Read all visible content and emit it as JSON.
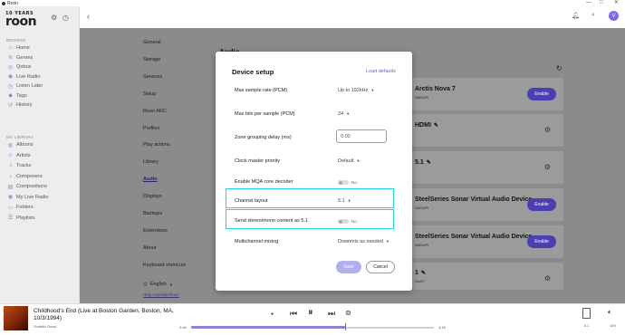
{
  "window": {
    "title": "Roon",
    "min_glyph": "—",
    "max_glyph": "□",
    "close_glyph": "✕"
  },
  "logo": {
    "sub": "10 YEARS",
    "main": "roon"
  },
  "sidebar": {
    "browse_label": "BROWSE",
    "browse_items": [
      {
        "label": "Home",
        "icon": "home-icon",
        "glyph": "⌂"
      },
      {
        "label": "Genres",
        "icon": "genres-icon",
        "glyph": "≋"
      },
      {
        "label": "Qobuz",
        "icon": "qobuz-icon",
        "glyph": "◎"
      },
      {
        "label": "Live Radio",
        "icon": "radio-icon",
        "glyph": "◉"
      },
      {
        "label": "Listen Later",
        "icon": "listen-later-icon",
        "glyph": "◷"
      },
      {
        "label": "Tags",
        "icon": "tag-icon",
        "glyph": "◆"
      },
      {
        "label": "History",
        "icon": "history-icon",
        "glyph": "↺"
      }
    ],
    "library_label": "MY LIBRARY",
    "library_items": [
      {
        "label": "Albums",
        "icon": "album-icon",
        "glyph": "◍"
      },
      {
        "label": "Artists",
        "icon": "artist-icon",
        "glyph": "☺"
      },
      {
        "label": "Tracks",
        "icon": "track-icon",
        "glyph": "♫"
      },
      {
        "label": "Composers",
        "icon": "composer-icon",
        "glyph": "♪"
      },
      {
        "label": "Compositions",
        "icon": "composition-icon",
        "glyph": "▤"
      },
      {
        "label": "My Live Radio",
        "icon": "my-radio-icon",
        "glyph": "◉"
      },
      {
        "label": "Folders",
        "icon": "folder-icon",
        "glyph": "▭"
      },
      {
        "label": "Playlists",
        "icon": "playlist-icon",
        "glyph": "☰"
      }
    ]
  },
  "settings_nav": [
    "General",
    "Storage",
    "Services",
    "Setup",
    "Roon ARC",
    "Profiles",
    "Play actions",
    "Library",
    "Audio",
    "Displays",
    "Backups",
    "Extensions",
    "About",
    "Keyboard shortcuts"
  ],
  "settings_active": "Audio",
  "language": {
    "value": "English",
    "help": "Help translate Roon"
  },
  "audio": {
    "title": "Audio"
  },
  "devices": [
    {
      "name": "Arctis Nova 7",
      "sub": "WASAPI",
      "action": "Enable"
    },
    {
      "name": "HDMI",
      "sub": "",
      "action": "gear"
    },
    {
      "name": "5.1",
      "sub": "",
      "action": "gear"
    },
    {
      "name": "SteelSeries Sonar Virtual Audio Device",
      "sub": "WASAPI",
      "action": "Enable"
    },
    {
      "name": "SteelSeries Sonar Virtual Audio Device",
      "sub": "WASAPI",
      "action": "Enable"
    },
    {
      "name": "1",
      "sub": "RAAT",
      "action": "gear"
    }
  ],
  "modal": {
    "title": "Device setup",
    "load_defaults": "Load defaults",
    "rows": {
      "max_sample_rate": {
        "label": "Max sample rate (PCM)",
        "value": "Up to 192kHz"
      },
      "max_bits": {
        "label": "Max bits per sample (PCM)",
        "value": "24"
      },
      "zone_grouping": {
        "label": "Zone grouping delay (ms)",
        "value": "0.00"
      },
      "clock_master": {
        "label": "Clock master priority",
        "value": "Default"
      },
      "mqa": {
        "label": "Enable MQA core decoder",
        "value": "No"
      },
      "channel_layout": {
        "label": "Channel layout",
        "value": "5.1"
      },
      "stereo_as_51": {
        "label": "Send stereo/mono content as 5.1",
        "value": "No"
      },
      "multichannel": {
        "label": "Multichannel mixing",
        "value": "Downmix as needed"
      }
    },
    "save": "Save",
    "cancel": "Cancel"
  },
  "player": {
    "title": "Childhood's End (Live at Boston Garden, Boston, MA, 10/3/1994)",
    "artist": "Grateful Dead",
    "elapsed": "2:44",
    "duration": "4:19",
    "progress": 0.634,
    "zone": "5.1",
    "volume": "100",
    "accent": "#8c7fd8"
  }
}
